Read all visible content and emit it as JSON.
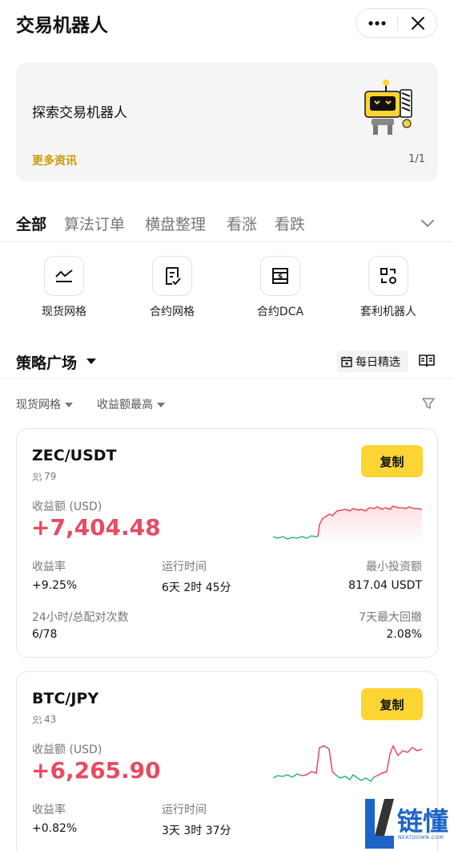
{
  "header": {
    "title": "交易机器人",
    "more_icon": "more-dots-icon",
    "close_icon": "close-icon"
  },
  "banner": {
    "title": "探索交易机器人",
    "more_link": "更多资讯",
    "pager": "1/1"
  },
  "tabs": {
    "items": [
      {
        "label": "全部",
        "active": true
      },
      {
        "label": "算法订单",
        "active": false
      },
      {
        "label": "横盘整理",
        "active": false
      },
      {
        "label": "看涨",
        "active": false
      },
      {
        "label": "看跌",
        "active": false
      }
    ]
  },
  "quick_actions": [
    {
      "label": "现货网格",
      "icon": "spot-grid-icon"
    },
    {
      "label": "合约网格",
      "icon": "futures-grid-icon"
    },
    {
      "label": "合约DCA",
      "icon": "futures-dca-icon"
    },
    {
      "label": "套利机器人",
      "icon": "arbitrage-bot-icon"
    }
  ],
  "strategy_square": {
    "title": "策略广场",
    "daily_pick": "每日精选"
  },
  "filters": {
    "type": "现货网格",
    "sort": "收益额最高"
  },
  "cards": [
    {
      "pair": "ZEC/USDT",
      "users": "79",
      "copy_label": "复制",
      "pnl_label": "收益额 (USD)",
      "pnl": "+7,404.48",
      "roi_label": "收益率",
      "roi": "+9.25%",
      "runtime_label": "运行时间",
      "runtime": "6天 2时 45分",
      "min_invest_label": "最小投资额",
      "min_invest": "817.04 USDT",
      "matched_label": "24小时/总配对次数",
      "matched": "6/78",
      "drawdown_label": "7天最大回撤",
      "drawdown": "2.08%"
    },
    {
      "pair": "BTC/JPY",
      "users": "43",
      "copy_label": "复制",
      "pnl_label": "收益额 (USD)",
      "pnl": "+6,265.90",
      "roi_label": "收益率",
      "roi": "+0.82%",
      "runtime_label": "运行时间",
      "runtime": "3天 3时 37分"
    }
  ],
  "watermark": {
    "text": "链懂",
    "sub": "NEATDOWN.COM"
  },
  "colors": {
    "accent": "#fcd535",
    "profit": "#e64b62",
    "spark_up": "#e64b62",
    "spark_down": "#2eb872"
  }
}
